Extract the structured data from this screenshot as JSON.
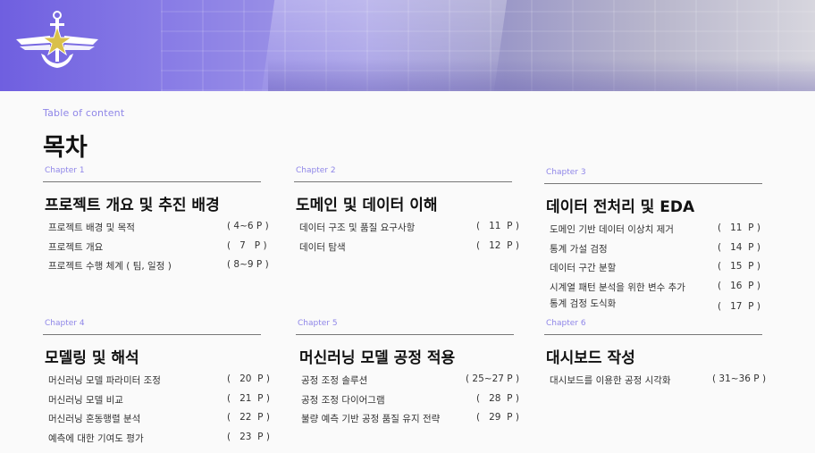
{
  "header": {
    "toc_label": "Table of content",
    "title": "목차"
  },
  "sections": [
    {
      "chapter": "Chapter 1",
      "title": "프로젝트 개요 및 추진 배경",
      "items": [
        {
          "name": "프로젝트 배경 및 목적",
          "page": "( 4~6 P )"
        },
        {
          "name": "프로젝트 개요",
          "page": "(   7   P )"
        },
        {
          "name": "프로젝트 수행 체계 ( 팀, 일정 )",
          "page": "( 8~9 P )"
        }
      ]
    },
    {
      "chapter": "Chapter 2",
      "title": "도메인 및 데이터 이해",
      "items": [
        {
          "name": "데이터 구조 및 품질 요구사항",
          "page": "(   11  P )"
        },
        {
          "name": "데이터 탐색",
          "page": "(   12  P )"
        }
      ]
    },
    {
      "chapter": "Chapter 3",
      "title": "데이터 전처리 및 EDA",
      "items": [
        {
          "name": "도메인 기반 데이터 이상치 제거",
          "page": "(   11  P )"
        },
        {
          "name": "통계 가설 검정",
          "page": "(   14  P )"
        },
        {
          "name": "데이터 구간 분할",
          "page": "(   15  P )"
        },
        {
          "name": "시계열 패턴 분석을 위한 변수 추가",
          "page": "(   16  P )"
        },
        {
          "name": "통계 검정 도식화",
          "page": "(   17  P )"
        }
      ]
    },
    {
      "chapter": "Chapter 4",
      "title": "모델링 및 해석",
      "items": [
        {
          "name": "머신러닝 모델 파라미터 조정",
          "page": "(   20  P )"
        },
        {
          "name": "머신러닝 모델 비교",
          "page": "(   21  P )"
        },
        {
          "name": "머신러닝 혼동행렬 분석",
          "page": "(   22  P )"
        },
        {
          "name": "예측에 대한 기여도 평가",
          "page": "(   23  P )"
        }
      ]
    },
    {
      "chapter": "Chapter 5",
      "title": "머신러닝 모델 공정 적용",
      "items": [
        {
          "name": "공정 조정 솔루션",
          "page": "( 25~27 P )"
        },
        {
          "name": "공정 조정 다이어그램",
          "page": "(   28  P )"
        },
        {
          "name": "불량 예측 기반 공정 품질 유지 전략",
          "page": "(   29  P )"
        }
      ]
    },
    {
      "chapter": "Chapter 6",
      "title": "대시보드 작성",
      "items": [
        {
          "name": "대시보드를 이용한 공정 시각화",
          "page": "( 31~36 P )"
        }
      ]
    }
  ]
}
